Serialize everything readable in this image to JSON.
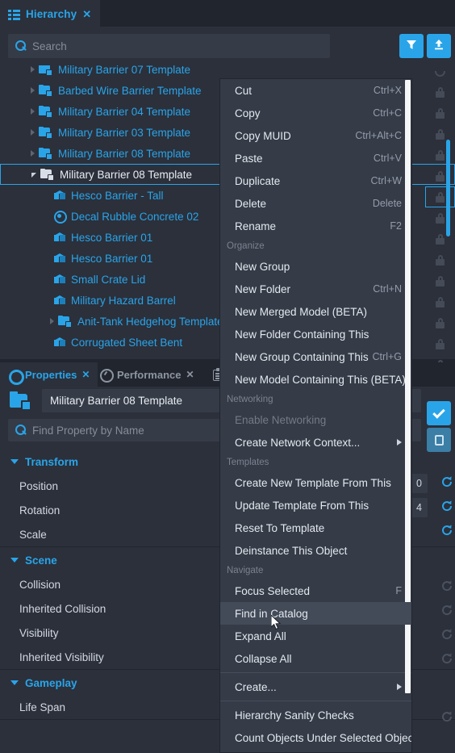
{
  "hierarchy_panel": {
    "tab": {
      "label": "Hierarchy",
      "close": "✕",
      "icon": "hierarchy-icon"
    },
    "search": {
      "placeholder": "Search",
      "value": ""
    },
    "buttons": [
      {
        "name": "filter-button",
        "icon": "filter-icon",
        "color": "#2aa4e8"
      },
      {
        "name": "upload-button",
        "icon": "upload-icon",
        "color": "#2aa4e8"
      }
    ],
    "tree": [
      {
        "label": "Military Barrier 07 Template",
        "icon": "template-folder-icon",
        "indent": 1,
        "arrow": "collapsed",
        "selected": false,
        "clipped": true
      },
      {
        "label": "Barbed Wire Barrier Template",
        "icon": "template-folder-icon",
        "indent": 1,
        "arrow": "collapsed",
        "selected": false
      },
      {
        "label": "Military Barrier 04 Template",
        "icon": "template-folder-icon",
        "indent": 1,
        "arrow": "collapsed",
        "selected": false
      },
      {
        "label": "Military Barrier 03 Template",
        "icon": "template-folder-icon",
        "indent": 1,
        "arrow": "collapsed",
        "selected": false
      },
      {
        "label": "Military Barrier 08 Template",
        "icon": "template-folder-icon",
        "indent": 1,
        "arrow": "collapsed",
        "selected": false
      },
      {
        "label": "Military Barrier 08 Template",
        "icon": "template-folder-icon",
        "indent": 1,
        "arrow": "expanded",
        "selected": true
      },
      {
        "label": "Hesco Barrier - Tall",
        "icon": "mesh-cube-icon",
        "indent": 2,
        "arrow": "none",
        "selected": false
      },
      {
        "label": "Decal Rubble Concrete 02",
        "icon": "decal-icon",
        "indent": 2,
        "arrow": "none",
        "selected": false
      },
      {
        "label": "Hesco Barrier 01",
        "icon": "mesh-cube-icon",
        "indent": 2,
        "arrow": "none",
        "selected": false
      },
      {
        "label": "Hesco Barrier 01",
        "icon": "mesh-cube-icon",
        "indent": 2,
        "arrow": "none",
        "selected": false
      },
      {
        "label": "Small Crate Lid",
        "icon": "mesh-cube-icon",
        "indent": 2,
        "arrow": "none",
        "selected": false
      },
      {
        "label": "Military Hazard Barrel",
        "icon": "mesh-cube-icon",
        "indent": 2,
        "arrow": "none",
        "selected": false
      },
      {
        "label": "Anit-Tank Hedgehog Template",
        "icon": "template-folder-icon",
        "indent": 2,
        "arrow": "collapsed",
        "selected": false
      },
      {
        "label": "Corrugated Sheet Bent",
        "icon": "mesh-cube-icon",
        "indent": 2,
        "arrow": "none",
        "selected": false
      }
    ],
    "lock_column": {
      "icon": "lock-icon",
      "count": 14,
      "highlighted_index": 5
    },
    "visibility_toggle": {
      "icon": "eye-icon"
    }
  },
  "properties_panel": {
    "tabs": [
      {
        "label": "Properties",
        "icon": "gear-icon",
        "close": "✕",
        "active": true
      },
      {
        "label": "Performance",
        "icon": "performance-gauge-icon",
        "close": "✕",
        "active": false
      }
    ],
    "extra_tab_icon": "clipboard-icon",
    "object": {
      "name": "Military Barrier 08 Template",
      "icon": "template-folder-icon"
    },
    "find": {
      "placeholder": "Find Property by Name",
      "value": ""
    },
    "sections": [
      {
        "title": "Transform",
        "expanded": true,
        "rows": [
          {
            "label": "Position"
          },
          {
            "label": "Rotation"
          },
          {
            "label": "Scale"
          }
        ]
      },
      {
        "title": "Scene",
        "expanded": true,
        "rows": [
          {
            "label": "Collision"
          },
          {
            "label": "Inherited Collision"
          },
          {
            "label": "Visibility"
          },
          {
            "label": "Inherited Visibility"
          }
        ]
      },
      {
        "title": "Gameplay",
        "expanded": true,
        "rows": [
          {
            "label": "Life Span"
          }
        ]
      }
    ],
    "widgets": {
      "checked_toggle": {
        "icon": "checkmark-icon",
        "color": "#2aa4e8"
      },
      "paste_button": {
        "icon": "paste-icon",
        "color": "#3b7ea6"
      },
      "reset_icon": "reset-arrow-icon",
      "number_values": [
        "0",
        "4"
      ]
    }
  },
  "context_menu": {
    "groups": [
      {
        "header": "",
        "items": [
          {
            "label": "Cut",
            "shortcut": "Ctrl+X"
          },
          {
            "label": "Copy",
            "shortcut": "Ctrl+C"
          },
          {
            "label": "Copy MUID",
            "shortcut": "Ctrl+Alt+C"
          },
          {
            "label": "Paste",
            "shortcut": "Ctrl+V"
          },
          {
            "label": "Duplicate",
            "shortcut": "Ctrl+W"
          },
          {
            "label": "Delete",
            "shortcut": "Delete"
          },
          {
            "label": "Rename",
            "shortcut": "F2"
          }
        ]
      },
      {
        "header": "Organize",
        "items": [
          {
            "label": "New Group",
            "shortcut": ""
          },
          {
            "label": "New Folder",
            "shortcut": "Ctrl+N"
          },
          {
            "label": "New Merged Model (BETA)",
            "shortcut": ""
          },
          {
            "label": "New Folder Containing This",
            "shortcut": ""
          },
          {
            "label": "New Group Containing This",
            "shortcut": "Ctrl+G"
          },
          {
            "label": "New Model Containing This (BETA)",
            "shortcut": ""
          }
        ]
      },
      {
        "header": "Networking",
        "items": [
          {
            "label": "Enable Networking",
            "shortcut": "",
            "disabled": true
          },
          {
            "label": "Create Network Context...",
            "shortcut": "",
            "submenu": true
          }
        ]
      },
      {
        "header": "Templates",
        "items": [
          {
            "label": "Create New Template From This",
            "shortcut": ""
          },
          {
            "label": "Update Template From This",
            "shortcut": ""
          },
          {
            "label": "Reset To Template",
            "shortcut": ""
          },
          {
            "label": "Deinstance This Object",
            "shortcut": ""
          }
        ]
      },
      {
        "header": "Navigate",
        "items": [
          {
            "label": "Focus Selected",
            "shortcut": "F"
          },
          {
            "label": "Find in Catalog",
            "shortcut": "",
            "hovered": true
          },
          {
            "label": "Expand All",
            "shortcut": ""
          },
          {
            "label": "Collapse All",
            "shortcut": ""
          }
        ]
      },
      {
        "header": "",
        "items": [
          {
            "label": "Create...",
            "shortcut": "",
            "submenu": true
          }
        ]
      },
      {
        "header": "",
        "items": [
          {
            "label": "Hierarchy Sanity Checks",
            "shortcut": ""
          },
          {
            "label": "Count Objects Under Selected Object",
            "shortcut": ""
          }
        ]
      }
    ]
  },
  "theme": {
    "accent": "#2aa4e8",
    "panel_bg": "#2b303b",
    "window_bg": "#21252e",
    "menu_bg": "#353b47",
    "menu_hover": "#434a58",
    "text": "#e4e9ef",
    "muted": "#7b8390"
  }
}
